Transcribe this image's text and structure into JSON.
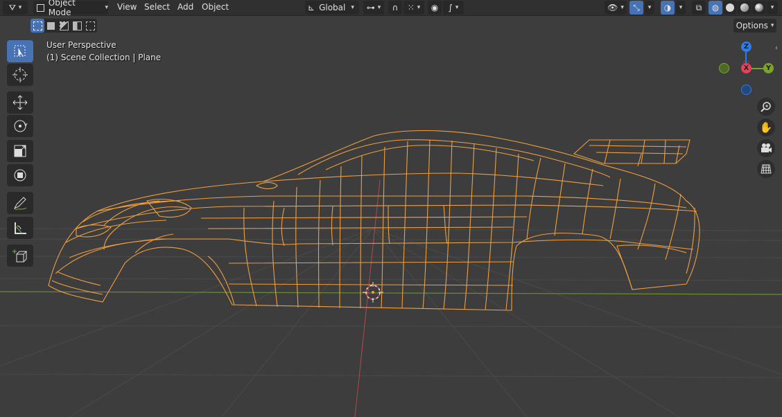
{
  "header": {
    "mode_label": "Object Mode",
    "menus": [
      "View",
      "Select",
      "Add",
      "Object"
    ],
    "transform_orientation": "Global",
    "options_label": "Options"
  },
  "overlay": {
    "view_name": "User Perspective",
    "collection_info": "(1) Scene Collection | Plane"
  },
  "gizmo": {
    "z_label": "Z",
    "x_label": "X",
    "y_label": "Y"
  },
  "colors": {
    "wireframe": "#f0a040",
    "x_axis": "#e84159",
    "y_axis": "#7aa52a",
    "z_axis": "#2f7be8",
    "active_blue": "#4772b3",
    "header_bg": "#303030",
    "viewport_bg": "#3d3d3d"
  },
  "toolbar_icons": [
    "select-box-icon",
    "cursor-icon",
    "move-icon",
    "rotate-icon",
    "scale-icon",
    "transform-icon",
    "annotate-icon",
    "measure-icon",
    "add-cube-icon"
  ],
  "nav_icons": [
    "zoom-icon",
    "pan-hand-icon",
    "camera-icon",
    "grid-ortho-icon"
  ]
}
